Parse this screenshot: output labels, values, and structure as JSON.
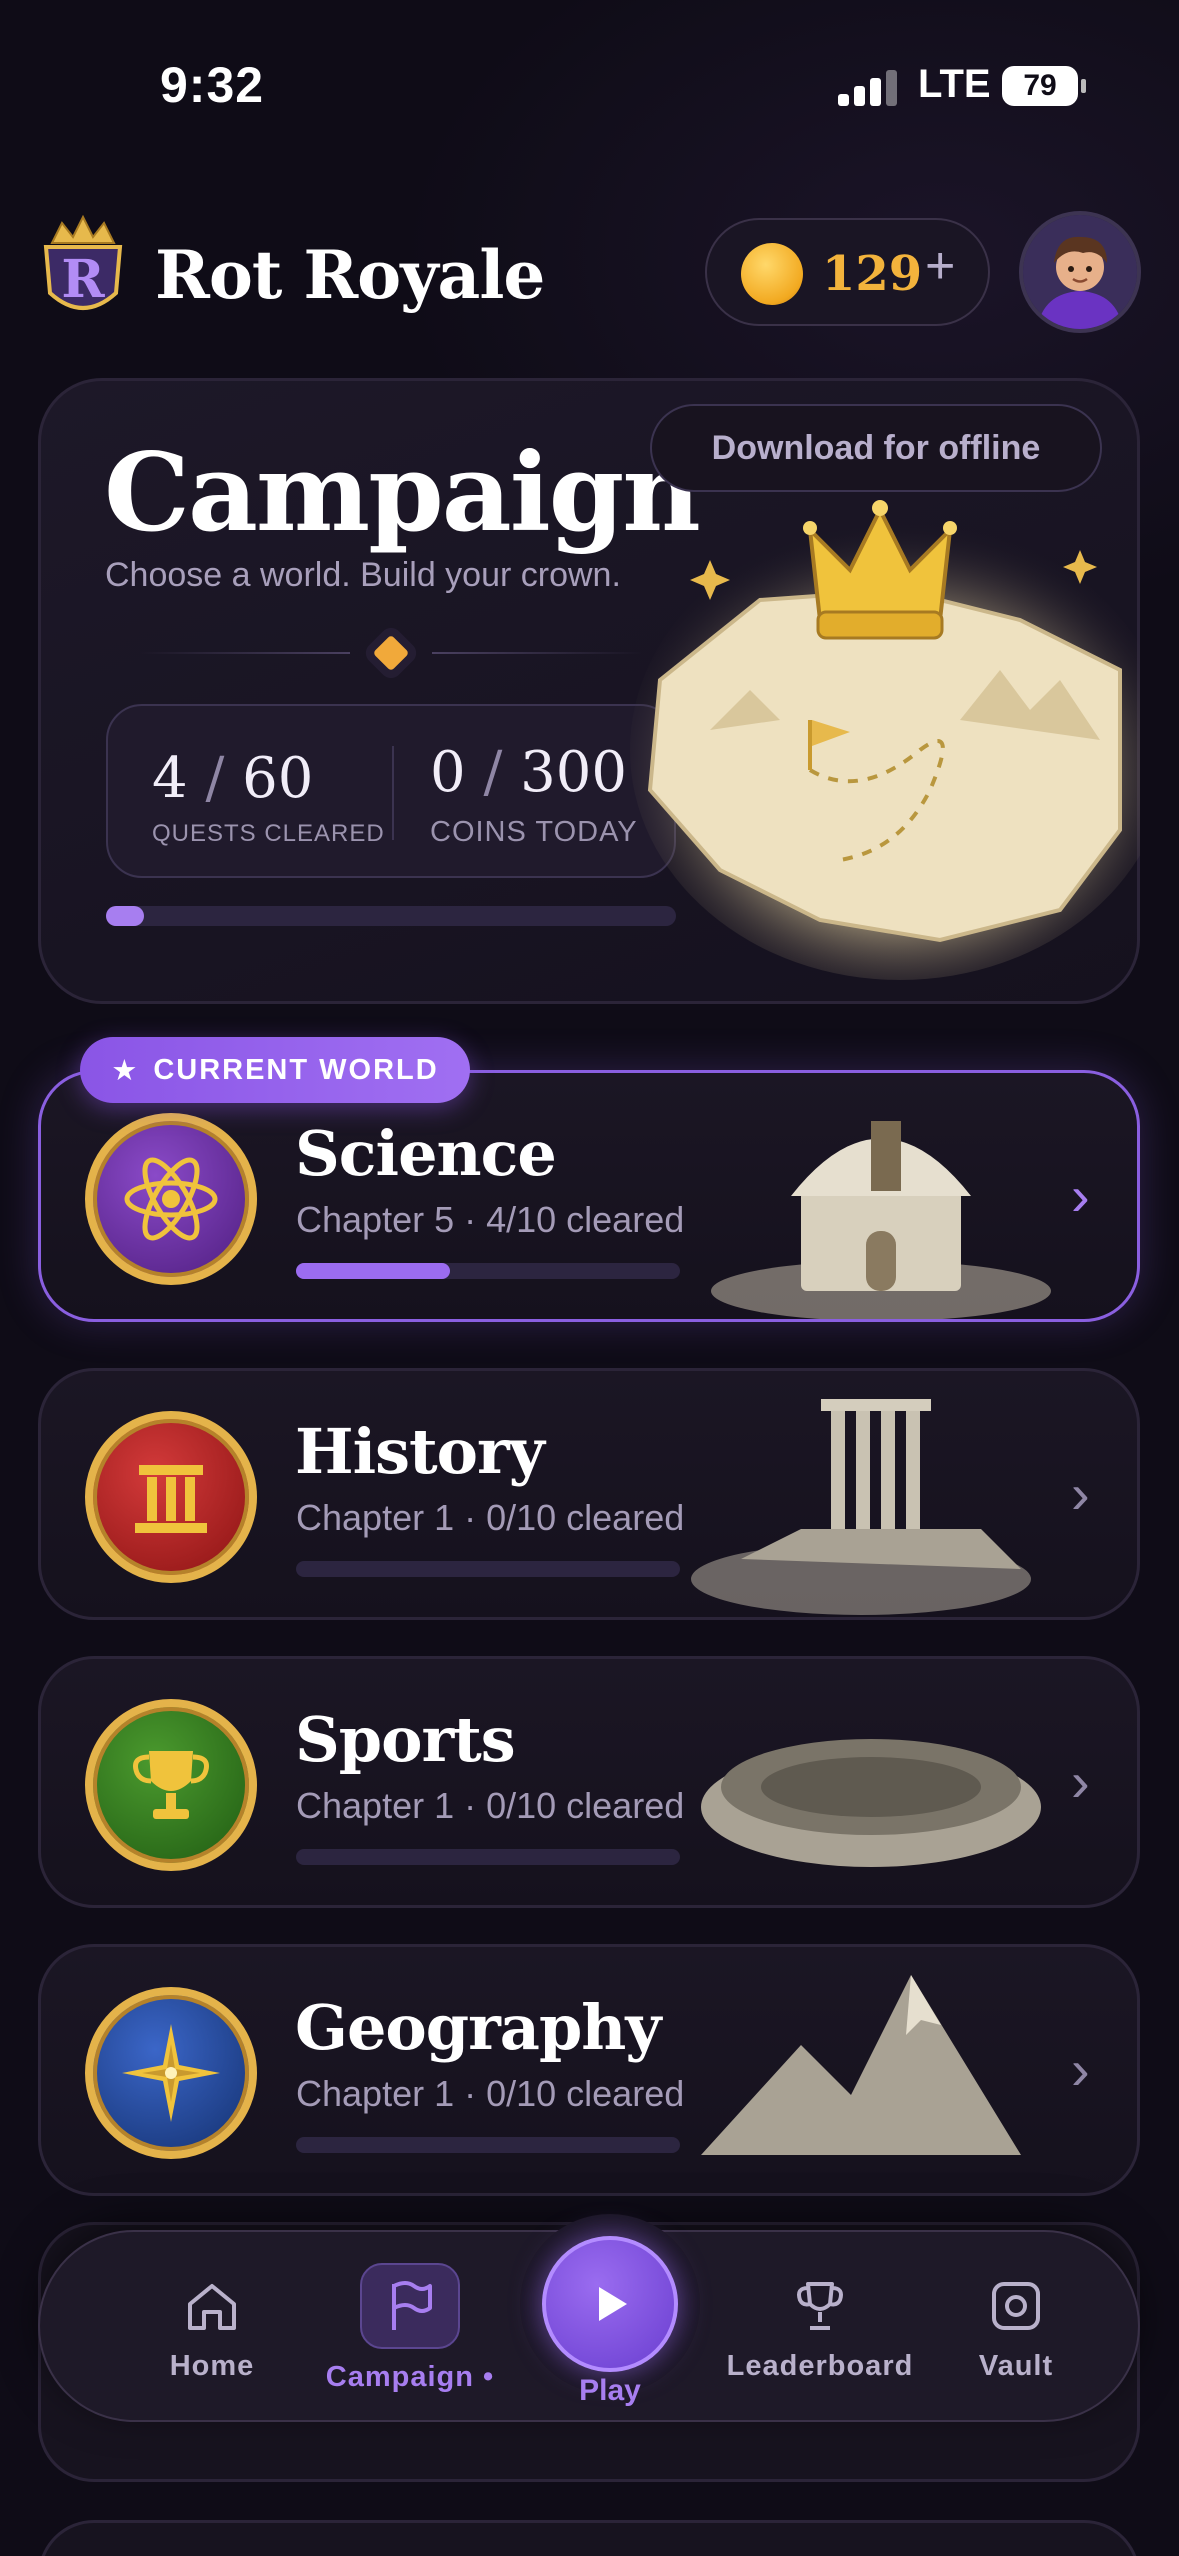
{
  "status_bar": {
    "time": "9:32",
    "network": "LTE",
    "battery": "79"
  },
  "header": {
    "app_title": "Rot Royale",
    "coins": "129",
    "add_label": "+",
    "logo_letter": "R"
  },
  "hero": {
    "download_label": "Download for offline",
    "title": "Campaign",
    "subtitle": "Choose a world. Build your crown.",
    "quests_cleared": "4",
    "quests_total": "60",
    "quests_label": "QUESTS CLEARED",
    "coins_today": "0",
    "coins_today_total": "300",
    "coins_today_label": "COINS TODAY",
    "progress": 0.0667
  },
  "current_world_tag": "CURRENT WORLD",
  "worlds": [
    {
      "title": "Science",
      "subtitle": "Chapter 5 · 4/10 cleared",
      "progress": 0.4,
      "current": true,
      "icon": "atom-icon",
      "color": "#6b2fa3"
    },
    {
      "title": "History",
      "subtitle": "Chapter 1 · 0/10 cleared",
      "progress": 0.0,
      "current": false,
      "icon": "column-icon",
      "color": "#a51e1e"
    },
    {
      "title": "Sports",
      "subtitle": "Chapter 1 · 0/10 cleared",
      "progress": 0.0,
      "current": false,
      "icon": "trophy-icon",
      "color": "#2f6b1f"
    },
    {
      "title": "Geography",
      "subtitle": "Chapter 1 · 0/10 cleared",
      "progress": 0.0,
      "current": false,
      "icon": "compass-icon",
      "color": "#1f3f8a"
    }
  ],
  "tabbar": {
    "home": "Home",
    "campaign": "Campaign",
    "campaign_dot": "•",
    "play": "Play",
    "leaderboard": "Leaderboard",
    "vault": "Vault"
  }
}
